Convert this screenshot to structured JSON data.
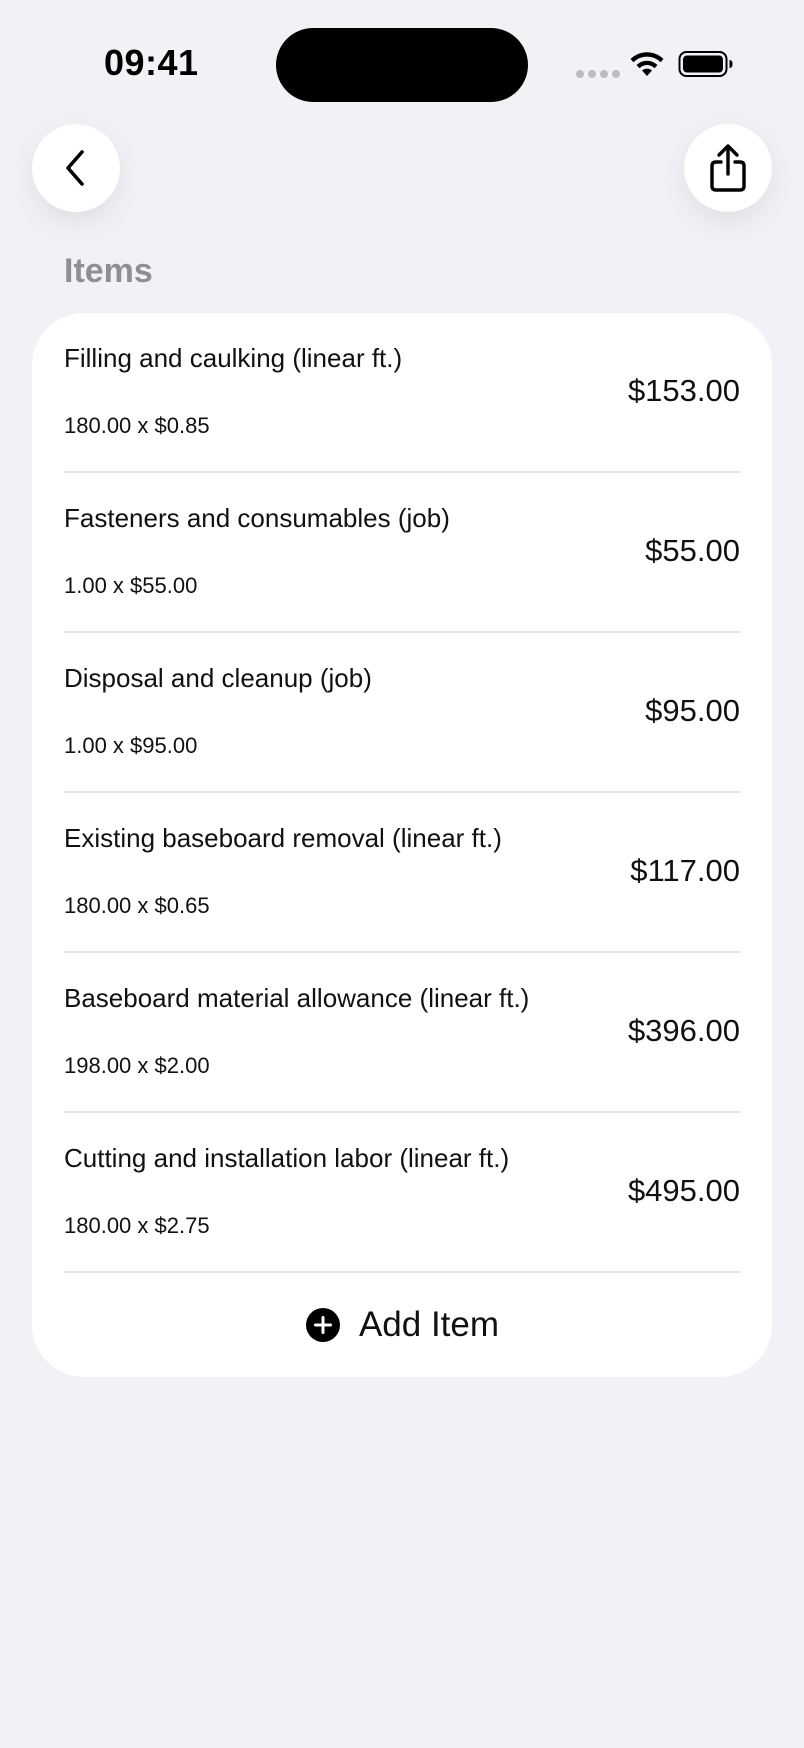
{
  "status_bar": {
    "time": "09:41"
  },
  "nav": {
    "back_icon": "chevron-left-icon",
    "share_icon": "share-icon"
  },
  "section": {
    "title": "Items"
  },
  "items": [
    {
      "name": "Filling and caulking (linear ft.)",
      "detail": "180.00 x $0.85",
      "total": "$153.00"
    },
    {
      "name": "Fasteners and consumables (job)",
      "detail": "1.00 x $55.00",
      "total": "$55.00"
    },
    {
      "name": "Disposal and cleanup (job)",
      "detail": "1.00 x $95.00",
      "total": "$95.00"
    },
    {
      "name": "Existing baseboard removal (linear ft.)",
      "detail": "180.00 x $0.65",
      "total": "$117.00"
    },
    {
      "name": "Baseboard material allowance (linear ft.)",
      "detail": "198.00 x $2.00",
      "total": "$396.00"
    },
    {
      "name": "Cutting and installation labor (linear ft.)",
      "detail": "180.00 x $2.75",
      "total": "$495.00"
    }
  ],
  "add_item": {
    "label": "Add Item",
    "icon": "plus-circle-icon"
  }
}
